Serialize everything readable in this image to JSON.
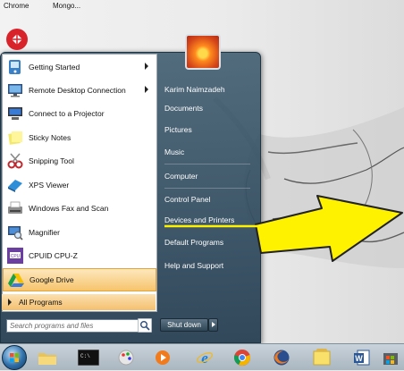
{
  "desktop": {
    "icons": [
      {
        "label": "Chrome",
        "icon": "chrome-icon"
      },
      {
        "label": "Mongo...",
        "icon": "mongo-icon"
      }
    ]
  },
  "start_menu": {
    "programs": [
      {
        "label": "Getting Started",
        "icon": "getting-started-icon",
        "has_submenu": true
      },
      {
        "label": "Remote Desktop Connection",
        "icon": "remote-desktop-icon",
        "has_submenu": true
      },
      {
        "label": "Connect to a Projector",
        "icon": "projector-icon",
        "has_submenu": false
      },
      {
        "label": "Sticky Notes",
        "icon": "sticky-notes-icon",
        "has_submenu": false
      },
      {
        "label": "Snipping Tool",
        "icon": "snipping-tool-icon",
        "has_submenu": false
      },
      {
        "label": "XPS Viewer",
        "icon": "xps-viewer-icon",
        "has_submenu": false
      },
      {
        "label": "Windows Fax and Scan",
        "icon": "fax-scan-icon",
        "has_submenu": false
      },
      {
        "label": "Magnifier",
        "icon": "magnifier-icon",
        "has_submenu": false
      },
      {
        "label": "CPUID CPU-Z",
        "icon": "cpuz-icon",
        "has_submenu": false
      },
      {
        "label": "Google Drive",
        "icon": "google-drive-icon",
        "has_submenu": false,
        "highlighted": true
      }
    ],
    "all_programs_label": "All Programs",
    "search_placeholder": "Search programs and files",
    "right_items": [
      "Karim Naimzadeh",
      "Documents",
      "Pictures",
      "Music",
      "Computer",
      "Control Panel",
      "Devices and Printers",
      "Default Programs",
      "Help and Support"
    ],
    "shutdown_label": "Shut down"
  },
  "annotation": {
    "arrow_color": "#fff200",
    "target": "Devices and Printers"
  },
  "taskbar": {
    "items": [
      "start-orb-icon",
      "folder-icon",
      "cmd-icon",
      "paint-icon",
      "media-player-icon",
      "ie-icon",
      "chrome-icon",
      "firefox-icon",
      "notes-icon",
      "word-icon",
      "store-icon"
    ]
  }
}
